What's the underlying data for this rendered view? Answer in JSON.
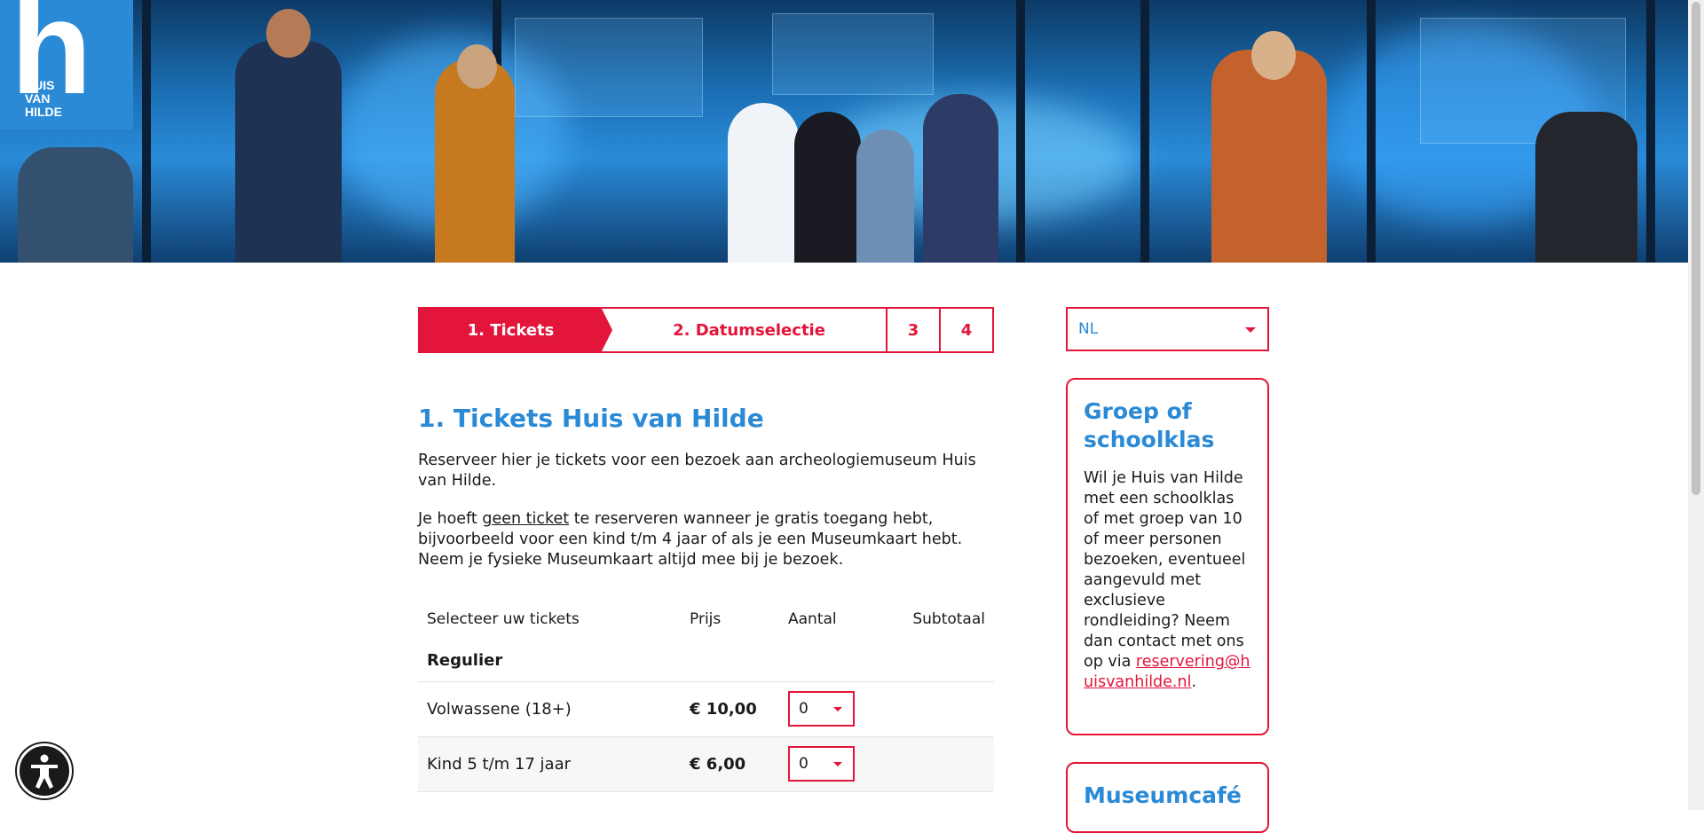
{
  "brand": {
    "logo_letter": "h",
    "logo_lines": [
      "HUIS",
      "VAN",
      "HILDE"
    ]
  },
  "steps": [
    {
      "label": "1. Tickets",
      "active": true
    },
    {
      "label": "2. Datumselectie",
      "active": false
    },
    {
      "label": "3",
      "active": false
    },
    {
      "label": "4",
      "active": false
    }
  ],
  "language": {
    "selected": "NL"
  },
  "main": {
    "title": "1. Tickets Huis van Hilde",
    "intro": "Reserveer hier je tickets voor een bezoek aan archeologiemuseum Huis van Hilde.",
    "notice_before": "Je hoeft ",
    "notice_link": "geen ticket",
    "notice_after": " te reserveren wanneer je gratis toegang hebt, bijvoorbeeld voor een kind t/m 4 jaar of als je een Museumkaart hebt. Neem je fysieke Museumkaart altijd mee bij je bezoek."
  },
  "tickets": {
    "headers": {
      "name": "Selecteer uw tickets",
      "price": "Prijs",
      "qty": "Aantal",
      "subtotal": "Subtotaal"
    },
    "group": "Regulier",
    "rows": [
      {
        "name": "Volwassene (18+)",
        "price": "€ 10,00",
        "qty": "0"
      },
      {
        "name": "Kind 5 t/m 17 jaar",
        "price": "€ 6,00",
        "qty": "0"
      }
    ]
  },
  "sidebar": {
    "group_card": {
      "title": "Groep of schoolklas",
      "body": "Wil je Huis van Hilde met een schoolklas of met groep van 10 of meer personen bezoeken, eventueel aangevuld met exclusieve rondleiding? Neem dan contact met ons op via ",
      "email": "reservering@huisvanhilde.nl",
      "after": "."
    },
    "cafe_card": {
      "title": "Museumcafé"
    }
  },
  "colors": {
    "brand_red": "#e3153a",
    "brand_blue": "#2a8ad6"
  },
  "icons": {
    "accessibility": "accessibility-icon",
    "select_caret": "chevron-down-icon"
  }
}
